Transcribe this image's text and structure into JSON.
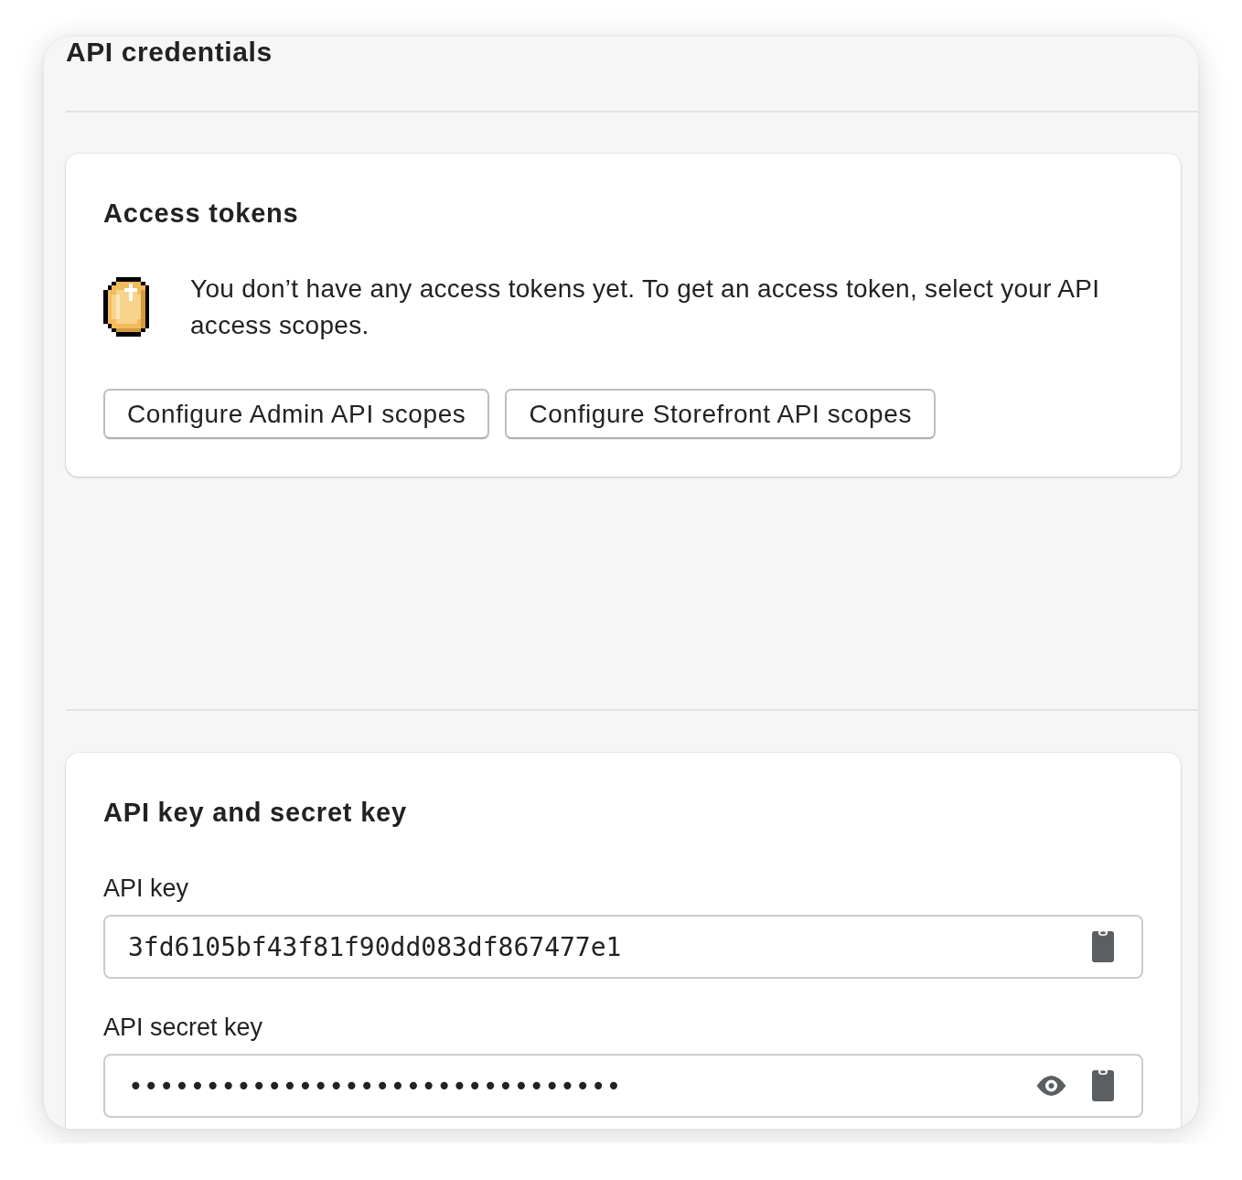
{
  "page": {
    "title": "API credentials"
  },
  "access_tokens_card": {
    "title": "Access tokens",
    "message": "You don’t have any access tokens yet. To get an access token, select your API access scopes.",
    "buttons": [
      {
        "label": "Configure Admin API scopes"
      },
      {
        "label": "Configure Storefront API scopes"
      }
    ]
  },
  "api_keys_card": {
    "title": "API key and secret key",
    "fields": [
      {
        "kind": "plain",
        "label": "API key",
        "value": "3fd6105bf43f81f90dd083df867477e1"
      },
      {
        "kind": "masked",
        "label": "API secret key",
        "value": "••••••••••••••••••••••••••••••••"
      }
    ]
  }
}
